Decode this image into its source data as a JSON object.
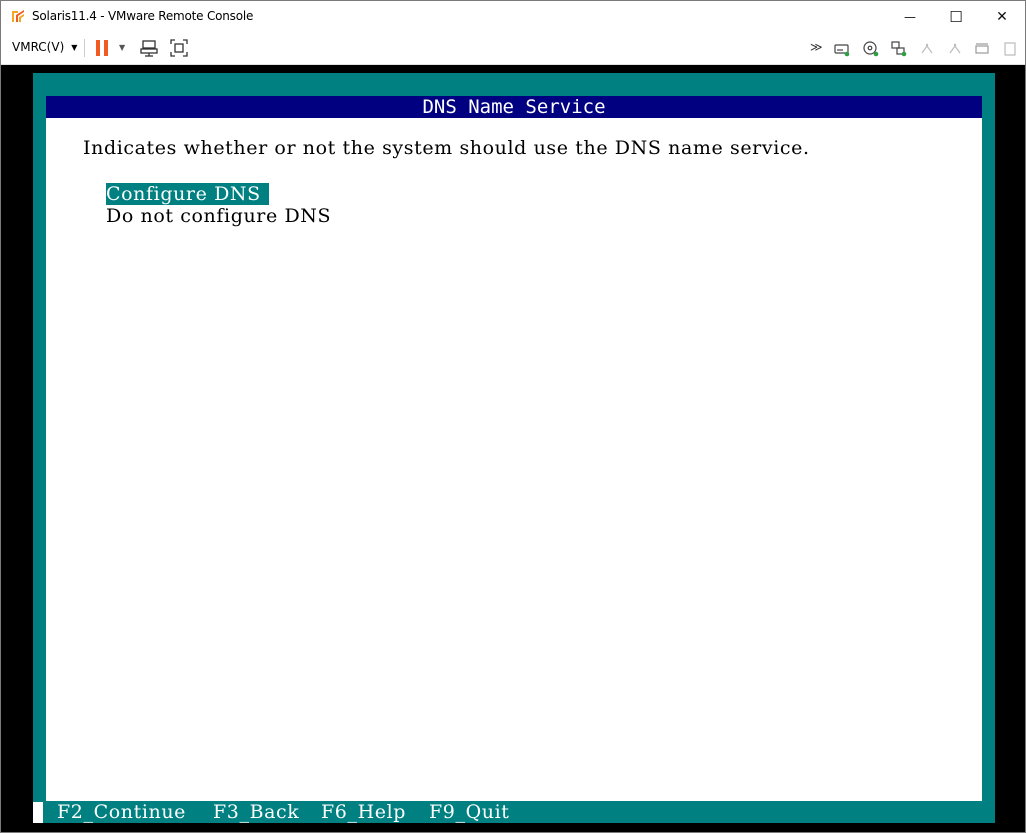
{
  "window": {
    "title": "Solaris11.4 - VMware Remote Console",
    "minimize_symbol": "—",
    "maximize_symbol": "☐",
    "close_symbol": "✕"
  },
  "toolbar": {
    "vmrc_label": "VMRC(V)",
    "vmrc_caret": "▼",
    "pause_caret": "▼",
    "accent_color": "#f15a22",
    "icons": [
      "pause-icon",
      "send-ctrl-alt-del-icon",
      "fullscreen-icon",
      "more-icon",
      "hard-disk-icon",
      "cd-dvd-icon",
      "network-adapter-icon",
      "usb-icon",
      "usb-icon-2",
      "printer-icon"
    ]
  },
  "console": {
    "header": "DNS Name Service",
    "description": "Indicates whether or not the system should use the DNS name service.",
    "options": [
      {
        "label": "Configure DNS",
        "selected": true
      },
      {
        "label": "Do not configure DNS",
        "selected": false
      }
    ],
    "function_keys": [
      "F2_Continue",
      "F3_Back",
      "F6_Help",
      "F9_Quit"
    ],
    "colors": {
      "frame": "#008080",
      "header_bg": "#000080",
      "background": "#ffffff",
      "selection_bg": "#008080"
    }
  }
}
